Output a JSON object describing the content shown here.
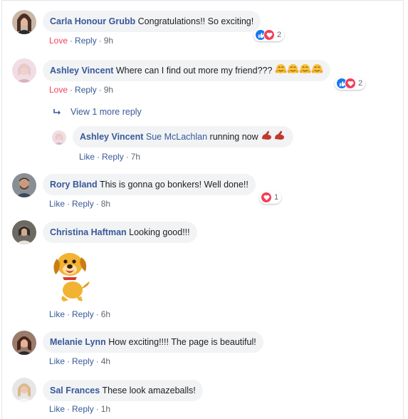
{
  "comments": [
    {
      "author": "Carla Honour Grubb",
      "text": "Congratulations!! So exciting!",
      "reaction_label": "Love",
      "reply": "Reply",
      "time": "9h",
      "reaction_count": "2"
    },
    {
      "author": "Ashley Vincent",
      "text": "Where can I find out more my friend???",
      "reaction_label": "Love",
      "reply": "Reply",
      "time": "9h",
      "reaction_count": "2"
    },
    {
      "author": "Rory Bland",
      "text": "This is gonna go bonkers! Well done!!",
      "like": "Like",
      "reply": "Reply",
      "time": "8h",
      "reaction_count": "1"
    },
    {
      "author": "Christina Haftman",
      "text": "Looking good!!!",
      "like": "Like",
      "reply": "Reply",
      "time": "6h"
    },
    {
      "author": "Melanie Lynn",
      "text": "How exciting!!!! The page is beautiful!",
      "like": "Like",
      "reply": "Reply",
      "time": "4h"
    },
    {
      "author": "Sal Frances",
      "text": "These look amazeballs!",
      "like": "Like",
      "reply": "Reply",
      "time": "1h"
    }
  ],
  "view_more": "View 1 more reply",
  "reply_comment": {
    "author": "Ashley Vincent",
    "mention": "Sue McLachlan",
    "text": "running now",
    "like": "Like",
    "reply": "Reply",
    "time": "7h"
  },
  "colors": {
    "link": "#385898",
    "love": "#f33e58",
    "like_blue": "#1877f2",
    "bubble": "#f2f3f5",
    "meta": "#606770"
  },
  "icons": [
    "like-reaction-icon",
    "love-reaction-icon",
    "hug-emoji-icon",
    "flexed-arm-emoji-icon",
    "reply-arrow-icon",
    "dog-sticker"
  ]
}
